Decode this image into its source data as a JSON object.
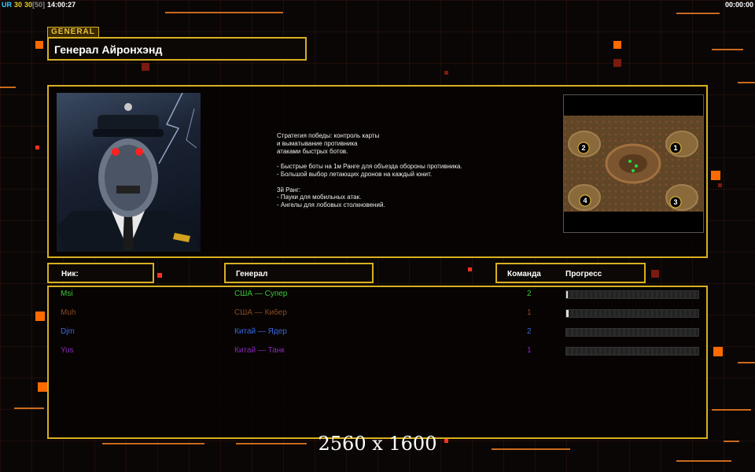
{
  "hud": {
    "ur_label": "UR",
    "fps": "30",
    "fps2": "30",
    "fps_cap": "[50]",
    "clock": "14:00:27",
    "timer": "00:00:00"
  },
  "general": {
    "badge": "GENERAL",
    "title": "Генерал Айронхэнд"
  },
  "description": "Стратегия победы: контроль карты\nи выматывание противника\nатаками быстрых ботов.\n\n- Быстрые боты на 1м Ранге для объезда обороны противника.\n- Большой выбор летающих дронов на каждый юнит.\n\n3й Ранг:\n- Пауки для мобильных атак.\n- Ангелы для лобовых столкновений.",
  "minimap": {
    "positions": [
      "1",
      "2",
      "3",
      "4"
    ]
  },
  "headers": {
    "nick": "Ник:",
    "general": "Генерал",
    "team": "Команда",
    "progress": "Прогресс"
  },
  "players": [
    {
      "nick": "Msi",
      "general": "США — Супер",
      "team": "2",
      "color": "#3cc83c",
      "progress": 0.01
    },
    {
      "nick": "Muh",
      "general": "США — Кибер",
      "team": "1",
      "color": "#8a4a28",
      "progress": 0.02
    },
    {
      "nick": "Djm",
      "general": "Китай — Ядер",
      "team": "2",
      "color": "#3a6ae0",
      "progress": 0.0
    },
    {
      "nick": "Yus",
      "general": "Китай — Танк",
      "team": "1",
      "color": "#8a2ab8",
      "progress": 0.0
    }
  ],
  "colors": {
    "accent": "#d8b020",
    "deco_orange": "#ff6a00",
    "ur_color": "#3ad0ff",
    "fps_color": "#e8d020"
  },
  "resolution_label": "2560 x 1600"
}
